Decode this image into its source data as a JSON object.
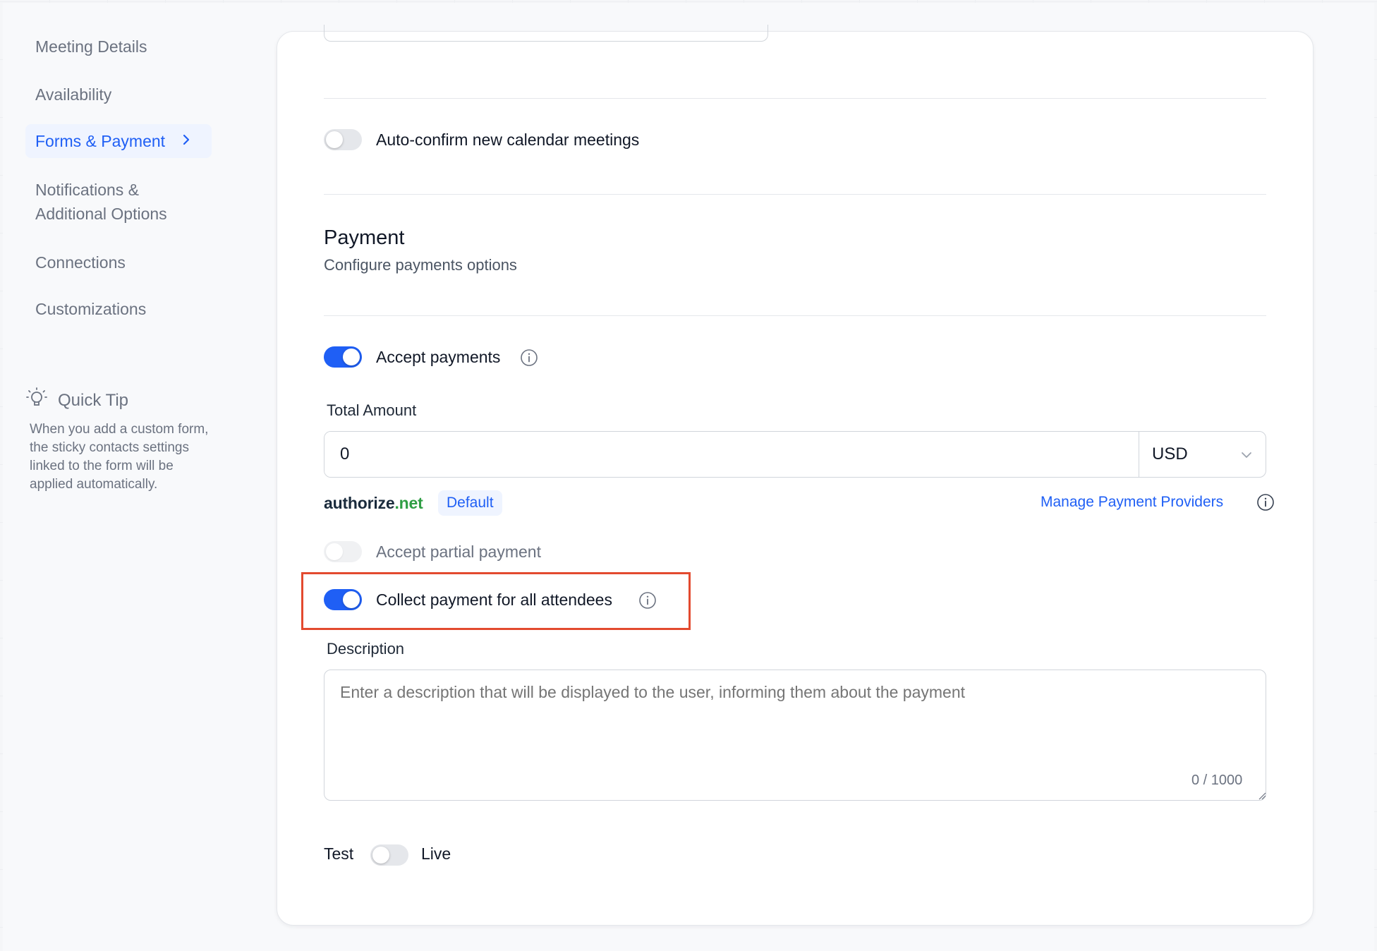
{
  "sidebar": {
    "items": [
      {
        "label": "Meeting Details",
        "active": false
      },
      {
        "label": "Availability",
        "active": false
      },
      {
        "label": "Forms & Payment",
        "active": true
      },
      {
        "label": "Notifications & Additional Options",
        "active": false
      },
      {
        "label": "Connections",
        "active": false
      },
      {
        "label": "Customizations",
        "active": false
      }
    ],
    "tip": {
      "title": "Quick Tip",
      "body": "When you add a custom form, the sticky contacts settings linked to the form will be applied automatically."
    }
  },
  "form": {
    "auto_confirm_label": "Auto-confirm new calendar meetings",
    "auto_confirm_on": false,
    "payment_title": "Payment",
    "payment_subtitle": "Configure payments options",
    "accept_payments_label": "Accept payments",
    "accept_payments_on": true,
    "total_amount_label": "Total Amount",
    "total_amount_value": "0",
    "currency": "USD",
    "provider_name_a": "authorize",
    "provider_name_b": ".net",
    "provider_badge": "Default",
    "manage_providers_label": "Manage Payment Providers",
    "partial_payment_label": "Accept partial payment",
    "partial_payment_on": false,
    "collect_all_label": "Collect payment for all attendees",
    "collect_all_on": true,
    "description_label": "Description",
    "description_placeholder": "Enter a description that will be displayed to the user, informing them about the payment",
    "description_counter": "0 / 1000",
    "mode_test_label": "Test",
    "mode_live_label": "Live",
    "live_mode_on": false
  },
  "colors": {
    "accent": "#1f5ff5",
    "highlight": "#e34a2f"
  }
}
